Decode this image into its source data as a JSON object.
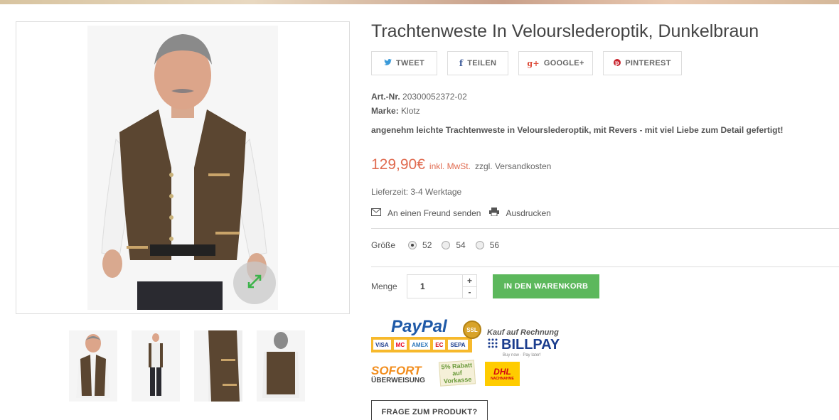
{
  "product": {
    "title": "Trachtenweste In Velourslederoptik, Dunkelbraun",
    "art_nr_label": "Art.-Nr.",
    "art_nr": "20300052372-02",
    "brand_label": "Marke:",
    "brand": "Klotz",
    "description": "angenehm leichte Trachtenweste in Velourslederoptik, mit Revers  - mit viel Liebe zum Detail gefertigt!",
    "price": "129,90€",
    "vat_note": "inkl. MwSt.",
    "shipping_note": "zzgl. Versandkosten",
    "delivery": "Lieferzeit: 3-4 Werktage"
  },
  "share": {
    "tweet": "TWEET",
    "teilen": "TEILEN",
    "google": "GOOGLE+",
    "pinterest": "PINTEREST"
  },
  "actions": {
    "send_friend": "An einen Freund senden",
    "print": "Ausdrucken",
    "size_label": "Größe",
    "sizes": [
      "52",
      "54",
      "56"
    ],
    "selected_size": "52",
    "qty_label": "Menge",
    "qty_value": "1",
    "qty_plus": "+",
    "qty_minus": "-",
    "add_to_cart": "IN DEN WARENKORB",
    "ask_question": "FRAGE ZUM PRODUKT?"
  },
  "payment": {
    "paypal": "PayPal",
    "paypal_cards": [
      "VISA",
      "MC",
      "AMEX",
      "EC",
      "SEPA"
    ],
    "ssl": "SSL",
    "billpay_top": "Kauf auf Rechnung",
    "billpay": "BILLPAY",
    "billpay_sub": "Buy now · Pay later!",
    "sofort": "SOFORT",
    "sofort_sub": "ÜBERWEISUNG",
    "rabatt": "5% Rabatt auf Vorkasse",
    "dhl": "DHL",
    "dhl_sub": "NACHNAHME"
  },
  "colors": {
    "price": "#e06b50",
    "cart_button": "#5cb85c",
    "twitter": "#3a9ad9",
    "facebook": "#3b5998",
    "google": "#dd4b39",
    "pinterest": "#c8232c"
  }
}
